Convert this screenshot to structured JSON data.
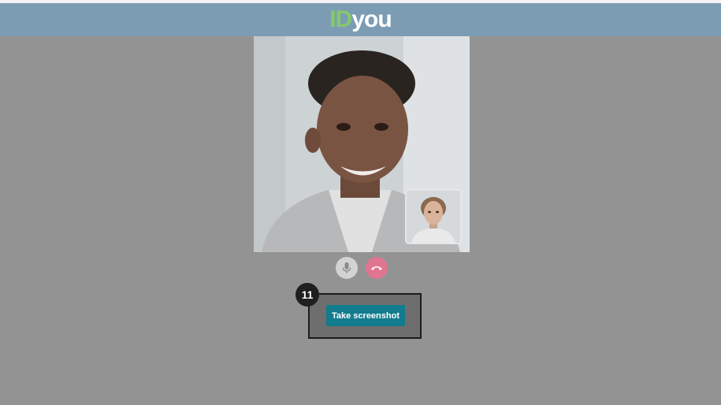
{
  "header": {
    "logo_id": "ID",
    "logo_you": "you"
  },
  "video_call": {
    "controls": [
      {
        "icon": "microphone-icon"
      },
      {
        "icon": "phone-hangup-icon"
      }
    ]
  },
  "step_badge": "11",
  "screenshot_button": {
    "label": "Take screenshot"
  },
  "colors": {
    "background": "#939393",
    "header": "#7c9cb4",
    "logo_accent": "#84c96d",
    "button": "#127b8d",
    "hangup": "#e0758f"
  }
}
